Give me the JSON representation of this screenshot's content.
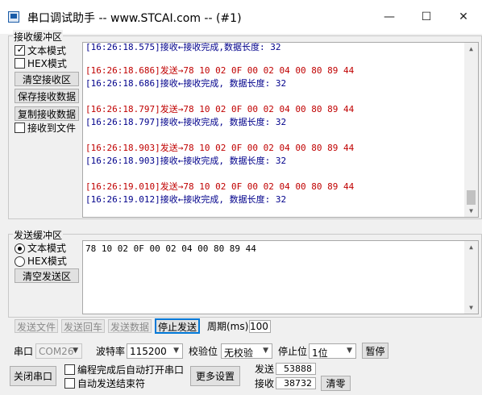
{
  "window": {
    "title": "串口调试助手 -- www.STCAI.com -- (#1)",
    "minimize_glyph": "—",
    "maximize_glyph": "☐",
    "close_glyph": "✕"
  },
  "receive_group": {
    "label": "接收缓冲区",
    "text_mode_label": "文本模式",
    "text_mode_checked": true,
    "hex_mode_label": "HEX模式",
    "hex_mode_checked": false,
    "clear_button": "清空接收区",
    "save_button": "保存接收数据",
    "copy_button": "复制接收数据",
    "to_file_label": "接收到文件",
    "to_file_checked": false,
    "log_top_partial": "[16:26:18.575]接收←接收完成,数据长度: 32",
    "log": [
      {
        "kind": "tx",
        "text": "[16:26:18.686]发送→78 10 02 0F 00 02 04 00 80 89 44"
      },
      {
        "kind": "rx",
        "text": "[16:26:18.686]接收←接收完成, 数据长度: 32"
      },
      {
        "kind": "tx",
        "text": "[16:26:18.797]发送→78 10 02 0F 00 02 04 00 80 89 44"
      },
      {
        "kind": "rx",
        "text": "[16:26:18.797]接收←接收完成, 数据长度: 32"
      },
      {
        "kind": "tx",
        "text": "[16:26:18.903]发送→78 10 02 0F 00 02 04 00 80 89 44"
      },
      {
        "kind": "rx",
        "text": "[16:26:18.903]接收←接收完成, 数据长度: 32"
      },
      {
        "kind": "tx",
        "text": "[16:26:19.010]发送→78 10 02 0F 00 02 04 00 80 89 44"
      },
      {
        "kind": "rx",
        "text": "[16:26:19.012]接收←接收完成, 数据长度: 32"
      }
    ]
  },
  "send_group": {
    "label": "发送缓冲区",
    "text_mode_label": "文本模式",
    "text_mode_selected": true,
    "hex_mode_label": "HEX模式",
    "hex_mode_selected": false,
    "clear_button": "清空发送区",
    "send_text": "78 10 02 0F 00 02 04 00 80 89 44"
  },
  "send_buttons": {
    "send_file": "发送文件",
    "send_enter": "发送回车",
    "send_data": "发送数据",
    "stop_send": "停止发送",
    "period_label": "周期(ms)",
    "period_value": "100"
  },
  "port_settings": {
    "port_label": "串口",
    "port_value": "COM26",
    "baud_label": "波特率",
    "baud_value": "115200",
    "parity_label": "校验位",
    "parity_value": "无校验",
    "stopbits_label": "停止位",
    "stopbits_value": "1位",
    "pause_button": "暂停"
  },
  "bottom": {
    "close_port_button": "关闭串口",
    "auto_open_label": "编程完成后自动打开串口",
    "auto_open_checked": false,
    "auto_send_end_label": "自动发送结束符",
    "auto_send_end_checked": false,
    "more_settings_button": "更多设置",
    "sent_label": "发送",
    "sent_count": "53888",
    "recv_label": "接收",
    "recv_count": "38732",
    "clear_counts_button": "清零"
  },
  "colors": {
    "tx_text": "#c00000",
    "rx_text": "#00008b",
    "focus_border": "#0078d7"
  }
}
